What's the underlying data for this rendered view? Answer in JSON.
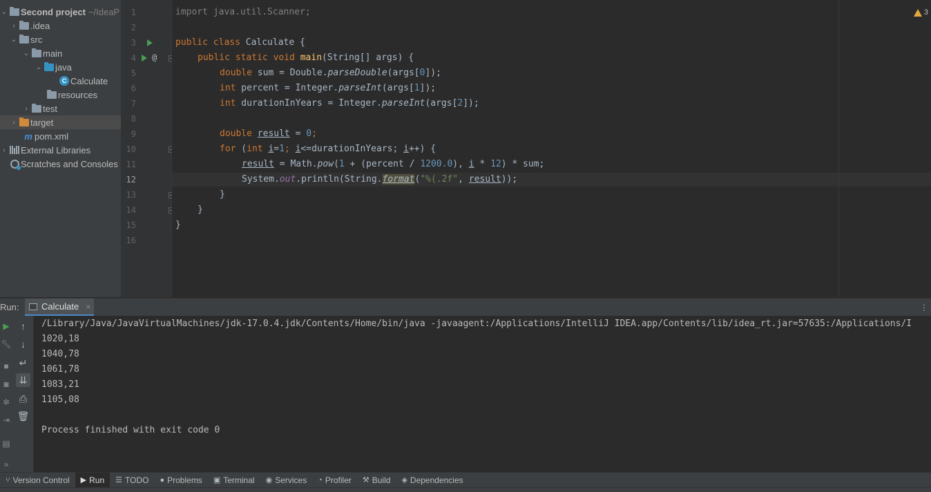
{
  "project_tree": {
    "items": [
      {
        "label": "Second project",
        "sub": "~/IdeaP",
        "icon": "folder-icon"
      },
      {
        "label": ".idea",
        "icon": "folder-icon"
      },
      {
        "label": "src",
        "icon": "folder-icon"
      },
      {
        "label": "main",
        "icon": "folder-icon"
      },
      {
        "label": "java",
        "icon": "source-folder-icon"
      },
      {
        "label": "Calculate",
        "icon": "class-icon",
        "icon_text": "C"
      },
      {
        "label": "resources",
        "icon": "resources-folder-icon"
      },
      {
        "label": "test",
        "icon": "folder-icon"
      },
      {
        "label": "target",
        "icon": "excluded-folder-icon"
      },
      {
        "label": "pom.xml",
        "icon": "maven-icon",
        "icon_text": "m"
      },
      {
        "label": "External Libraries",
        "icon": "libraries-icon"
      },
      {
        "label": "Scratches and Consoles",
        "icon": "scratches-icon"
      }
    ]
  },
  "editor": {
    "line_numbers": [
      "1",
      "2",
      "3",
      "4",
      "5",
      "6",
      "7",
      "8",
      "9",
      "10",
      "11",
      "12",
      "13",
      "14",
      "15",
      "16"
    ],
    "current_line": "12",
    "warnings_count": "3",
    "colors": {
      "keyword": "#cc7832",
      "function": "#ffc66d",
      "number": "#6897bb",
      "string": "#6a8759",
      "field": "#9876aa",
      "text": "#a9b7c6"
    },
    "code": {
      "l1_kw": "import",
      "l1_rest": " java.util.Scanner;",
      "l3_kw": "public class",
      "l3_name": " Calculate {",
      "l4_kw": "public static void",
      "l4_fn": "main",
      "l4_rest": "(String[] args) {",
      "l5_kw": "double",
      "l5_a": " sum = Double.",
      "l5_m": "parseDouble",
      "l5_b": "(args[",
      "l5_n": "0",
      "l5_c": "]);",
      "l6_kw": "int",
      "l6_a": " percent = Integer.",
      "l6_m": "parseInt",
      "l6_b": "(args[",
      "l6_n": "1",
      "l6_c": "]);",
      "l7_kw": "int",
      "l7_a": " durationInYears = Integer.",
      "l7_m": "parseInt",
      "l7_b": "(args[",
      "l7_n": "2",
      "l7_c": "]);",
      "l9_kw": "double",
      "l9_v": "result",
      "l9_a": " = ",
      "l9_n": "0",
      "l9_c": ";",
      "l10_kw": "for",
      "l10_a": " (",
      "l10_kw2": "int",
      "l10_i": "i",
      "l10_b": "=",
      "l10_n": "1",
      "l10_c": "; ",
      "l10_i2": "i",
      "l10_d": "<=durationInYears; ",
      "l10_i3": "i",
      "l10_e": "++) {",
      "l11_v": "result",
      "l11_a": " = Math.",
      "l11_m": "pow",
      "l11_b": "(",
      "l11_n1": "1",
      "l11_c": " + (percent / ",
      "l11_n2": "1200.0",
      "l11_d": "), ",
      "l11_i": "i",
      "l11_e": " * ",
      "l11_n3": "12",
      "l11_f": ") * sum;",
      "l12_a": "System.",
      "l12_out": "out",
      "l12_b": ".println(String.",
      "l12_m": "format",
      "l12_c": "(",
      "l12_s": "\"%(.2f\"",
      "l12_d": ", ",
      "l12_v": "result",
      "l12_e": "));",
      "l13": "}",
      "l14": "}",
      "l15": "}"
    }
  },
  "run_panel": {
    "label": "Run:",
    "tab_label": "Calculate",
    "tab_close": "×",
    "console_lines": [
      "/Library/Java/JavaVirtualMachines/jdk-17.0.4.jdk/Contents/Home/bin/java -javaagent:/Applications/IntelliJ IDEA.app/Contents/lib/idea_rt.jar=57635:/Applications/I",
      "1020,18",
      "1040,78",
      "1061,78",
      "1083,21",
      "1105,08",
      "",
      "Process finished with exit code 0"
    ]
  },
  "bottom_bar": {
    "items": [
      {
        "label": "Version Control",
        "icon": "version-control-icon"
      },
      {
        "label": "Run",
        "icon": "run-icon"
      },
      {
        "label": "TODO",
        "icon": "todo-icon"
      },
      {
        "label": "Problems",
        "icon": "problems-icon"
      },
      {
        "label": "Terminal",
        "icon": "terminal-icon"
      },
      {
        "label": "Services",
        "icon": "services-icon"
      },
      {
        "label": "Profiler",
        "icon": "profiler-icon"
      },
      {
        "label": "Build",
        "icon": "build-icon"
      },
      {
        "label": "Dependencies",
        "icon": "dependencies-icon"
      }
    ]
  }
}
